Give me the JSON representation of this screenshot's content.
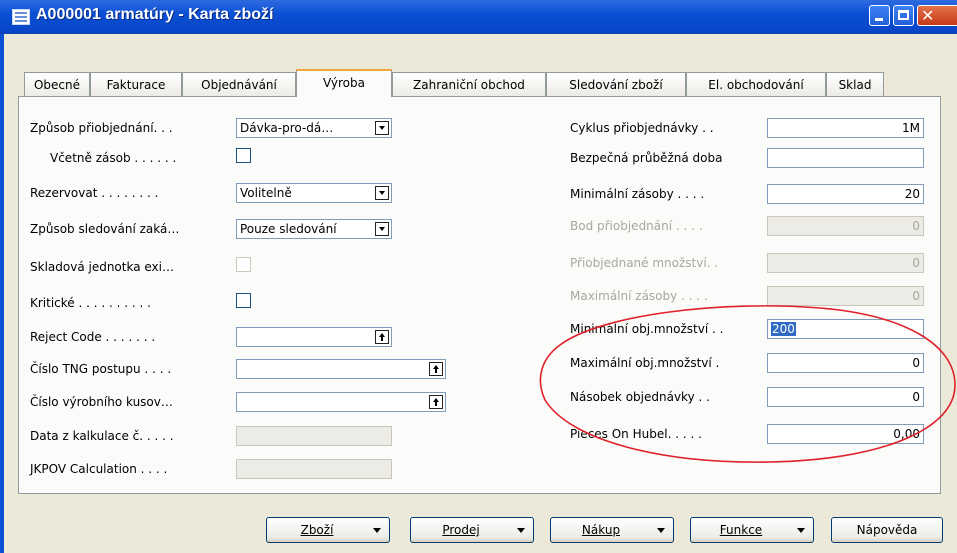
{
  "window": {
    "title": "A000001 armatúry - Karta zboží"
  },
  "tabs": [
    "Obecné",
    "Fakturace",
    "Objednávání",
    "Výroba",
    "Zahraniční obchod",
    "Sledování zboží",
    "El. obchodování",
    "Sklad"
  ],
  "left": {
    "reorder_policy_label": "Způsob přiobjednání. . .",
    "reorder_policy_value": "Dávka-pro-dá…",
    "include_inventory_label": "Včetně zásob . . . . . .",
    "reserve_label": "Rezervovat . . . . . . . .",
    "reserve_value": "Volitelně",
    "order_tracking_label": "Způsob sledování zaká…",
    "order_tracking_value": "Pouze sledování",
    "sku_exists_label": "Skladová jednotka exi…",
    "critical_label": "Kritické . . . . . . . . . .",
    "reject_code_label": "Reject Code . . . . . . .",
    "routing_no_label": "Číslo TNG postupu . . . .",
    "bom_no_label": "Číslo výrobního kusov…",
    "calc_data_label": "Data z kalkulace č. . . . .",
    "jkpov_label": "JKPOV Calculation . . . ."
  },
  "right": {
    "reorder_cycle_label": "Cyklus přiobjednávky . .",
    "reorder_cycle_value": "1M",
    "safety_lead_label": "Bezpečná průběžná doba",
    "safety_lead_value": "",
    "min_stock_label": "Minimální zásoby . . . .",
    "min_stock_value": "20",
    "reorder_point_label": "Bod přiobjednání . . . .",
    "reorder_point_value": "0",
    "reorder_qty_label": "Přiobjednané množství. .",
    "reorder_qty_value": "0",
    "max_stock_label": "Maximální zásoby . . . .",
    "max_stock_value": "0",
    "min_order_qty_label": "Minimální obj.množství . .",
    "min_order_qty_value": "200",
    "max_order_qty_label": "Maximální obj.množství .",
    "max_order_qty_value": "0",
    "order_multiple_label": "Násobek objednávky . .",
    "order_multiple_value": "0",
    "pieces_on_hubel_label": "Pieces On Hubel. . . . .",
    "pieces_on_hubel_value": "0,00"
  },
  "buttons": {
    "item": "Zboží",
    "sales": "Prodej",
    "purchase": "Nákup",
    "functions": "Funkce",
    "help": "Nápověda"
  },
  "colors": {
    "annotation": "#e0202a",
    "titlebar": "#0a4fd4",
    "tab_highlight": "#f1a93b"
  }
}
